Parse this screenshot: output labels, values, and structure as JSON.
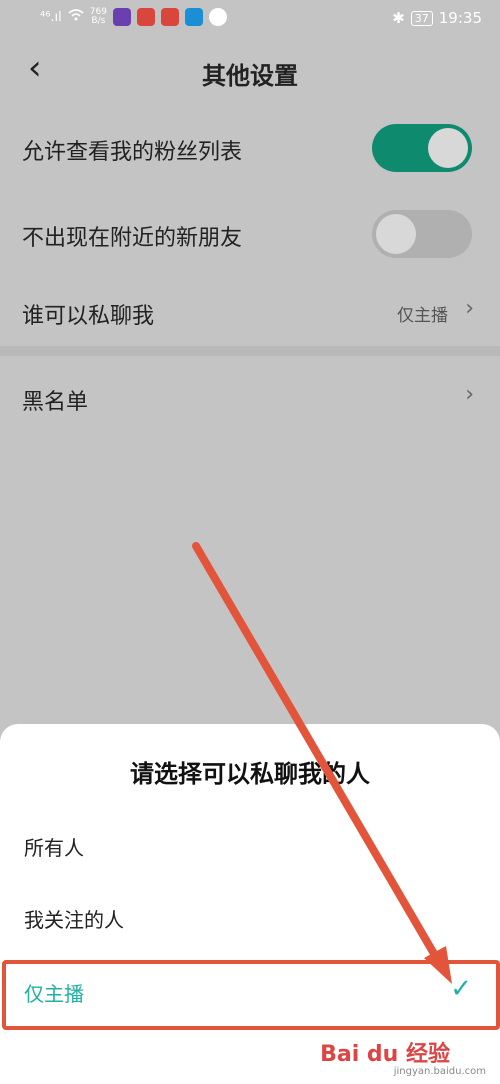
{
  "status_bar": {
    "left_signal": "⁴⁶.ıl",
    "net_speed_value": "769",
    "net_speed_unit": "B/s",
    "time": "19:35",
    "battery": "37"
  },
  "header": {
    "title": "其他设置"
  },
  "settings": {
    "allow_fans_list": {
      "label": "允许查看我的粉丝列表",
      "on": true
    },
    "hide_nearby": {
      "label": "不出现在附近的新朋友",
      "on": false
    },
    "who_can_chat": {
      "label": "谁可以私聊我",
      "value": "仅主播"
    },
    "blacklist": {
      "label": "黑名单"
    }
  },
  "sheet": {
    "title": "请选择可以私聊我的人",
    "options": [
      {
        "label": "所有人"
      },
      {
        "label": "我关注的人"
      },
      {
        "label": "仅主播",
        "selected": true
      }
    ]
  },
  "watermark": {
    "brand": "Bai du 经验",
    "url": "jingyan.baidu.com"
  },
  "colors": {
    "accent_green": "#0e8a6e",
    "teal": "#22b0a4",
    "annotation_red": "#e2553a"
  }
}
